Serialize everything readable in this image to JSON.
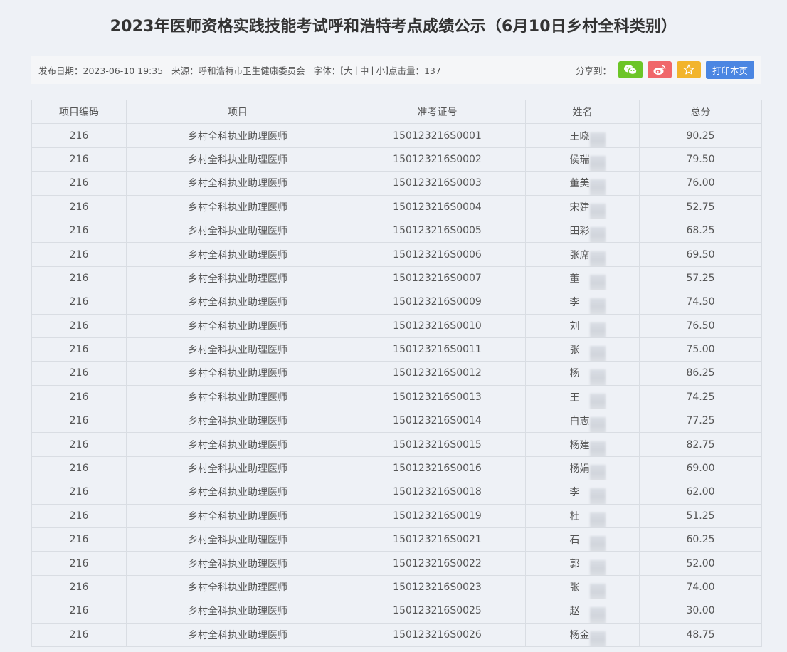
{
  "page": {
    "title": "2023年医师资格实践技能考试呼和浩特考点成绩公示（6月10日乡村全科类别）"
  },
  "meta": {
    "date_label": "发布日期：",
    "date": "2023-06-10 19:35",
    "source_label": "来源：",
    "source": "呼和浩特市卫生健康委员会",
    "font_label": "字体：",
    "font_open": "[",
    "font_large": "大",
    "font_medium": "中",
    "font_small": "小",
    "font_close": "]",
    "sep": "|",
    "clicks_label": "点击量：",
    "clicks": "137",
    "share_label": "分享到：",
    "print_label": "打印本页"
  },
  "icons": {
    "wechat": "wechat-icon",
    "weibo": "weibo-icon",
    "favorite": "star-icon"
  },
  "colors": {
    "wechat": "#6cc527",
    "weibo": "#f0676a",
    "favorite": "#f2b42c",
    "print": "#4b86e2"
  },
  "table": {
    "headers": [
      "项目编码",
      "项目",
      "准考证号",
      "姓名",
      "总分"
    ],
    "rows": [
      {
        "code": "216",
        "project": "乡村全科执业助理医师",
        "id": "150123216S0001",
        "name": "王晓",
        "score": "90.25"
      },
      {
        "code": "216",
        "project": "乡村全科执业助理医师",
        "id": "150123216S0002",
        "name": "侯瑞",
        "score": "79.50"
      },
      {
        "code": "216",
        "project": "乡村全科执业助理医师",
        "id": "150123216S0003",
        "name": "董美",
        "score": "76.00"
      },
      {
        "code": "216",
        "project": "乡村全科执业助理医师",
        "id": "150123216S0004",
        "name": "宋建",
        "score": "52.75"
      },
      {
        "code": "216",
        "project": "乡村全科执业助理医师",
        "id": "150123216S0005",
        "name": "田彩",
        "score": "68.25"
      },
      {
        "code": "216",
        "project": "乡村全科执业助理医师",
        "id": "150123216S0006",
        "name": "张席",
        "score": "69.50"
      },
      {
        "code": "216",
        "project": "乡村全科执业助理医师",
        "id": "150123216S0007",
        "name": "董",
        "score": "57.25"
      },
      {
        "code": "216",
        "project": "乡村全科执业助理医师",
        "id": "150123216S0009",
        "name": "李",
        "score": "74.50"
      },
      {
        "code": "216",
        "project": "乡村全科执业助理医师",
        "id": "150123216S0010",
        "name": "刘",
        "score": "76.50"
      },
      {
        "code": "216",
        "project": "乡村全科执业助理医师",
        "id": "150123216S0011",
        "name": "张",
        "score": "75.00"
      },
      {
        "code": "216",
        "project": "乡村全科执业助理医师",
        "id": "150123216S0012",
        "name": "杨",
        "score": "86.25"
      },
      {
        "code": "216",
        "project": "乡村全科执业助理医师",
        "id": "150123216S0013",
        "name": "王",
        "score": "74.25"
      },
      {
        "code": "216",
        "project": "乡村全科执业助理医师",
        "id": "150123216S0014",
        "name": "白志",
        "score": "77.25"
      },
      {
        "code": "216",
        "project": "乡村全科执业助理医师",
        "id": "150123216S0015",
        "name": "杨建",
        "score": "82.75"
      },
      {
        "code": "216",
        "project": "乡村全科执业助理医师",
        "id": "150123216S0016",
        "name": "杨娟",
        "score": "69.00"
      },
      {
        "code": "216",
        "project": "乡村全科执业助理医师",
        "id": "150123216S0018",
        "name": "李",
        "score": "62.00"
      },
      {
        "code": "216",
        "project": "乡村全科执业助理医师",
        "id": "150123216S0019",
        "name": "杜",
        "score": "51.25"
      },
      {
        "code": "216",
        "project": "乡村全科执业助理医师",
        "id": "150123216S0021",
        "name": "石",
        "score": "60.25"
      },
      {
        "code": "216",
        "project": "乡村全科执业助理医师",
        "id": "150123216S0022",
        "name": "郭",
        "score": "52.00"
      },
      {
        "code": "216",
        "project": "乡村全科执业助理医师",
        "id": "150123216S0023",
        "name": "张",
        "score": "74.00"
      },
      {
        "code": "216",
        "project": "乡村全科执业助理医师",
        "id": "150123216S0025",
        "name": "赵",
        "score": "30.00"
      },
      {
        "code": "216",
        "project": "乡村全科执业助理医师",
        "id": "150123216S0026",
        "name": "杨金",
        "score": "48.75"
      }
    ]
  }
}
